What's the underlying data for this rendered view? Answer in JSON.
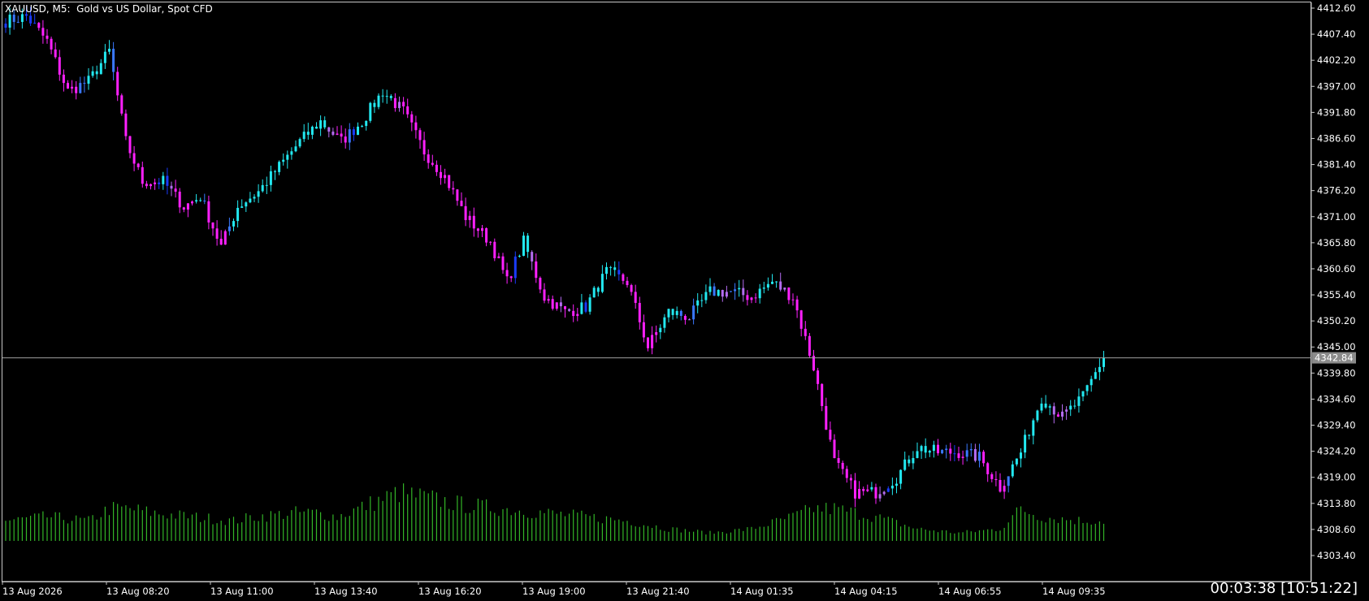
{
  "window": {
    "symbol": "XAUUSD",
    "timeframe": "M5",
    "description": "Gold vs US Dollar, Spot CFD",
    "title": "XAUUSD, M5:  Gold vs US Dollar, Spot CFD"
  },
  "timer": {
    "countdown": "00:03:38",
    "server_time": "[10:51:22]",
    "text": "00:03:38 [10:51:22]"
  },
  "colors": {
    "background": "#000000",
    "axis": "#c8c8c8",
    "bull": "#22e8f0",
    "bear": "#ff20ff",
    "neutral_blue": "#1a3cff",
    "volume": "#33b527",
    "bid_line": "#a0a0a0",
    "bid_label_bg": "#8a8a8a"
  },
  "chart_data": {
    "type": "candlestick",
    "price_axis_ticks": [
      "4412.60",
      "4407.40",
      "4402.20",
      "4397.00",
      "4391.80",
      "4386.60",
      "4381.40",
      "4376.20",
      "4371.00",
      "4365.80",
      "4360.60",
      "4355.40",
      "4350.20",
      "4345.00",
      "4339.80",
      "4334.60",
      "4329.40",
      "4324.20",
      "4319.00",
      "4313.80",
      "4308.60",
      "4303.40"
    ],
    "price_range": [
      4300.8,
      4414.2
    ],
    "current_price": "4342.84",
    "time_axis_labels": [
      "13 Aug 2026",
      "13 Aug 08:20",
      "13 Aug 11:00",
      "13 Aug 13:40",
      "13 Aug 16:20",
      "13 Aug 19:00",
      "13 Aug 21:40",
      "14 Aug 01:35",
      "14 Aug 04:15",
      "14 Aug 06:55",
      "14 Aug 09:35"
    ],
    "close_path": [
      [
        0,
        4410
      ],
      [
        5,
        4411
      ],
      [
        10,
        4406
      ],
      [
        15,
        4396
      ],
      [
        20,
        4398
      ],
      [
        25,
        4404
      ],
      [
        29,
        4386
      ],
      [
        33,
        4378
      ],
      [
        38,
        4378
      ],
      [
        43,
        4373
      ],
      [
        47,
        4375
      ],
      [
        52,
        4365
      ],
      [
        56,
        4373
      ],
      [
        61,
        4376
      ],
      [
        66,
        4381
      ],
      [
        71,
        4386
      ],
      [
        76,
        4390
      ],
      [
        81,
        4386
      ],
      [
        86,
        4390
      ],
      [
        91,
        4396
      ],
      [
        96,
        4392
      ],
      [
        101,
        4384
      ],
      [
        106,
        4379
      ],
      [
        111,
        4371
      ],
      [
        117,
        4366
      ],
      [
        121,
        4358
      ],
      [
        125,
        4366
      ],
      [
        130,
        4355
      ],
      [
        135,
        4352
      ],
      [
        140,
        4353
      ],
      [
        145,
        4360
      ],
      [
        150,
        4358
      ],
      [
        155,
        4345
      ],
      [
        160,
        4352
      ],
      [
        165,
        4351
      ],
      [
        170,
        4356
      ],
      [
        175,
        4356
      ],
      [
        180,
        4355
      ],
      [
        185,
        4358
      ],
      [
        190,
        4355
      ],
      [
        195,
        4341
      ],
      [
        200,
        4322
      ],
      [
        205,
        4316
      ],
      [
        210,
        4316
      ],
      [
        215,
        4319
      ],
      [
        220,
        4325
      ],
      [
        225,
        4324
      ],
      [
        230,
        4324
      ],
      [
        235,
        4323
      ],
      [
        240,
        4317
      ],
      [
        245,
        4324
      ],
      [
        250,
        4335
      ],
      [
        255,
        4331
      ],
      [
        260,
        4335
      ],
      [
        265,
        4343
      ]
    ],
    "volume_envelope": [
      [
        0,
        5
      ],
      [
        10,
        6
      ],
      [
        20,
        5
      ],
      [
        25,
        8
      ],
      [
        30,
        8
      ],
      [
        35,
        7
      ],
      [
        45,
        6
      ],
      [
        55,
        5
      ],
      [
        60,
        6
      ],
      [
        70,
        7
      ],
      [
        75,
        7
      ],
      [
        80,
        6
      ],
      [
        85,
        8
      ],
      [
        90,
        10
      ],
      [
        95,
        12
      ],
      [
        100,
        11
      ],
      [
        110,
        9
      ],
      [
        120,
        8
      ],
      [
        130,
        7
      ],
      [
        140,
        6
      ],
      [
        150,
        5
      ],
      [
        160,
        3
      ],
      [
        170,
        2
      ],
      [
        180,
        3
      ],
      [
        190,
        6
      ],
      [
        195,
        8
      ],
      [
        200,
        8
      ],
      [
        210,
        6
      ],
      [
        220,
        3
      ],
      [
        230,
        2
      ],
      [
        240,
        3
      ],
      [
        245,
        8
      ],
      [
        250,
        6
      ],
      [
        260,
        5
      ],
      [
        265,
        5
      ]
    ],
    "volume_range": [
      0,
      12.5
    ],
    "bar_count": 266
  }
}
